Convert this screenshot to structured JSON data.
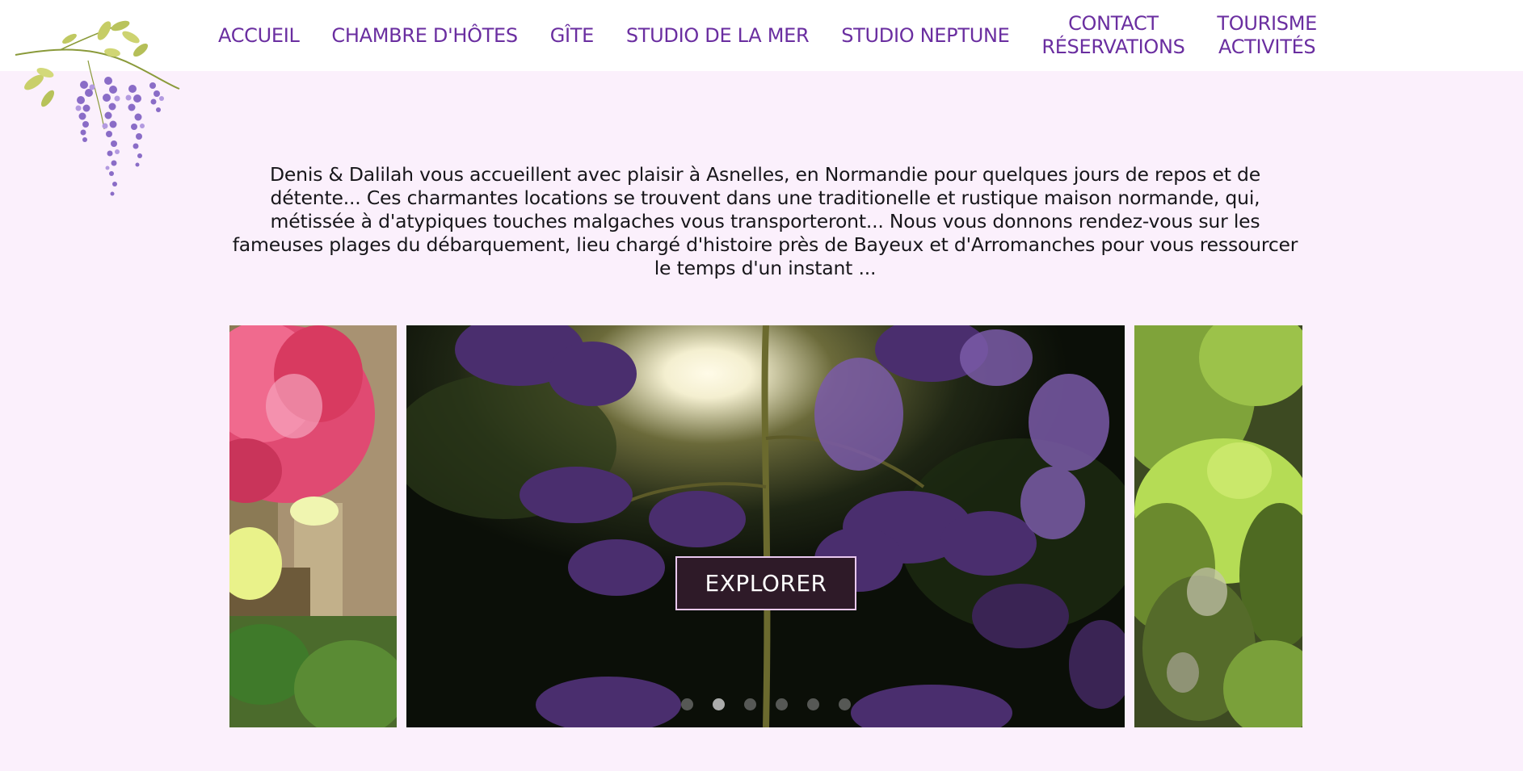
{
  "nav": {
    "items": [
      {
        "lines": [
          "ACCUEIL"
        ]
      },
      {
        "lines": [
          "CHAMBRE D'HÔTES"
        ]
      },
      {
        "lines": [
          "GÎTE"
        ]
      },
      {
        "lines": [
          "STUDIO DE LA MER"
        ]
      },
      {
        "lines": [
          "STUDIO NEPTUNE"
        ]
      },
      {
        "lines": [
          "CONTACT",
          "RÉSERVATIONS"
        ]
      },
      {
        "lines": [
          "TOURISME",
          "ACTIVITÉS"
        ]
      }
    ]
  },
  "logo": {
    "icon": "wisteria-branch-icon"
  },
  "intro": {
    "text": "Denis & Dalilah vous accueillent avec plaisir à Asnelles, en Normandie pour quelques jours de repos et de détente... Ces charmantes locations se trouvent dans une traditionelle et rustique maison normande, qui, métissée à d'atypiques touches malgaches vous transporteront... Nous vous donnons rendez-vous sur les fameuses plages du débarquement, lieu chargé d'histoire près de Bayeux et d'Arromanches pour vous ressourcer le temps d'un instant ..."
  },
  "slider": {
    "button_label": "EXPLORER",
    "dot_count": 6,
    "active_dot": 1
  },
  "colors": {
    "nav_text": "#6a2ea0",
    "page_background": "#fbf0fc",
    "button_background": "#2e1a28",
    "button_border": "#e9c8ef"
  }
}
